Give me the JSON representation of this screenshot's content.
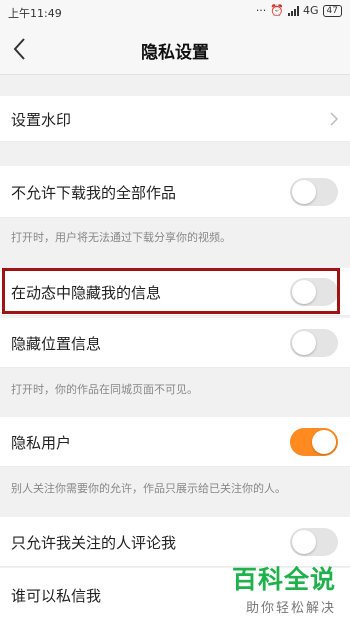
{
  "status_bar": {
    "time": "上午11:49",
    "dots": "···",
    "network": "4G",
    "battery": "47"
  },
  "header": {
    "title": "隐私设置"
  },
  "settings": {
    "watermark": {
      "label": "设置水印"
    },
    "no_download": {
      "label": "不允许下载我的全部作品",
      "on": false
    },
    "no_download_note": "打开时，用户将无法通过下载分享你的视频。",
    "hide_in_feed": {
      "label": "在动态中隐藏我的信息",
      "on": false
    },
    "hide_location": {
      "label": "隐藏位置信息",
      "on": false
    },
    "hide_location_note": "打开时，你的作品在同城页面不可见。",
    "private_user": {
      "label": "隐私用户",
      "on": true
    },
    "private_user_note": "别人关注你需要你的允许，作品只展示给已关注你的人。",
    "comment_follow_only": {
      "label": "只允许我关注的人评论我",
      "on": false
    },
    "who_can_message": {
      "label": "谁可以私信我"
    }
  },
  "watermark_logo": {
    "title": "百科全说",
    "subtitle": "助你轻松解决"
  },
  "colors": {
    "toggle_on": "#ff8a1f",
    "highlight_border": "#a11212",
    "logo_green": "#1fb14b"
  }
}
